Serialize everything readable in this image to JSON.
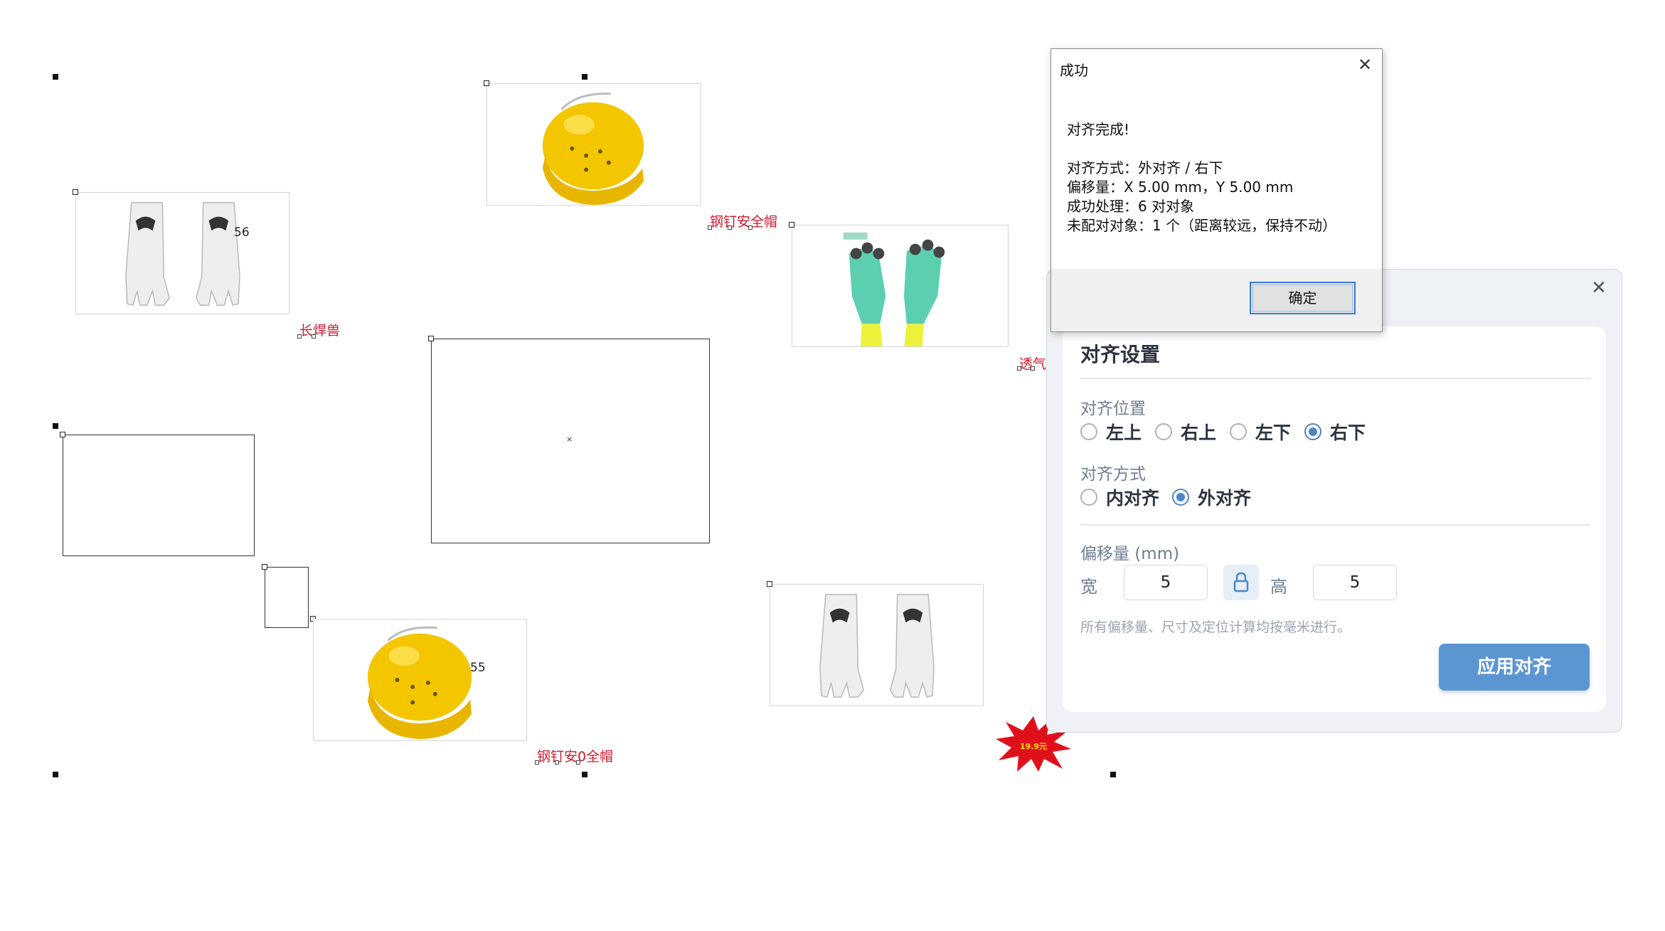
{
  "canvas": {
    "labels": {
      "helmet_top": "钢钉安全帽",
      "gloves_left": "长焊兽",
      "right_edge": "透气",
      "helmet_bottom": "钢钉安0全帽"
    },
    "image_numbers": {
      "gloves_left": "56",
      "helmet_bottom": "55"
    },
    "price_tag": "19.9元"
  },
  "settings_panel": {
    "close_icon": "close-icon",
    "title": "对齐设置",
    "position_label": "对齐位置",
    "position_options": [
      {
        "label": "左上",
        "checked": false
      },
      {
        "label": "右上",
        "checked": false
      },
      {
        "label": "左下",
        "checked": false
      },
      {
        "label": "右下",
        "checked": true
      }
    ],
    "mode_label": "对齐方式",
    "mode_options": [
      {
        "label": "内对齐",
        "checked": false
      },
      {
        "label": "外对齐",
        "checked": true
      }
    ],
    "offset_label": "偏移量 (mm)",
    "width_label": "宽",
    "width_value": "5",
    "height_label": "高",
    "height_value": "5",
    "lock_icon": "lock-icon",
    "note": "所有偏移量、尺寸及定位计算均按毫米进行。",
    "apply_button": "应用对齐",
    "accent_color": "#5b96d3"
  },
  "success_dialog": {
    "title": "成功",
    "lines": [
      "对齐完成!",
      "",
      "对齐方式：外对齐 / 右下",
      "偏移量：X 5.00 mm，Y 5.00 mm",
      "成功处理：6 对对象",
      "未配对对象：1 个（距离较远，保持不动）"
    ],
    "ok_button": "确定"
  }
}
